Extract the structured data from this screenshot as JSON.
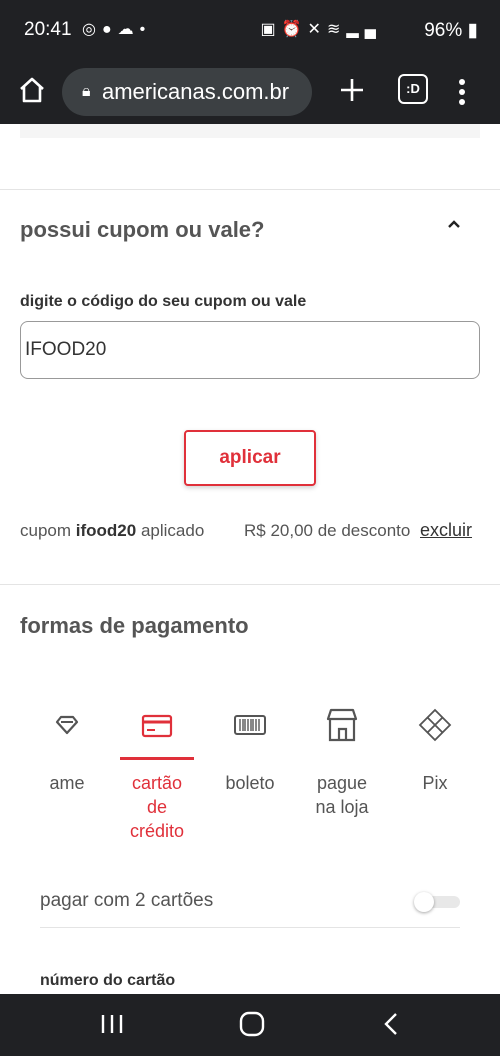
{
  "status_bar": {
    "time": "20:41",
    "battery": "96%",
    "left_icons": [
      "whatsapp-icon",
      "reddit-icon",
      "cloud-icon",
      "dot-icon"
    ],
    "right_icons": [
      "battery-saver-icon",
      "alarm-icon",
      "mute-icon",
      "wifi-icon",
      "lte-icon",
      "signal-icon"
    ]
  },
  "browser": {
    "url": "americanas.com.br",
    "tab_count": ":D"
  },
  "coupon": {
    "title": "possui cupom ou vale?",
    "field_label": "digite o código do seu cupom ou vale",
    "code_value": "IFOOD20",
    "apply_label": "aplicar",
    "applied_prefix": "cupom",
    "applied_code": "ifood20",
    "applied_suffix": "aplicado",
    "discount_text": "R$ 20,00 de desconto",
    "remove_label": "excluir"
  },
  "payment": {
    "title": "formas de pagamento",
    "methods": [
      {
        "label": "ame",
        "icon": "ame-icon",
        "active": false
      },
      {
        "label": "cartão de crédito",
        "icon": "credit-card-icon",
        "active": true
      },
      {
        "label": "boleto",
        "icon": "barcode-icon",
        "active": false
      },
      {
        "label": "pague na loja",
        "icon": "store-icon",
        "active": false
      },
      {
        "label": "Pix",
        "icon": "pix-icon",
        "active": false
      }
    ],
    "two_cards_label": "pagar com 2 cartões",
    "two_cards_enabled": false,
    "card_number_label": "número do cartão"
  },
  "colors": {
    "accent": "#e0303a",
    "chrome_dark": "#202124",
    "url_pill": "#3c4043"
  }
}
